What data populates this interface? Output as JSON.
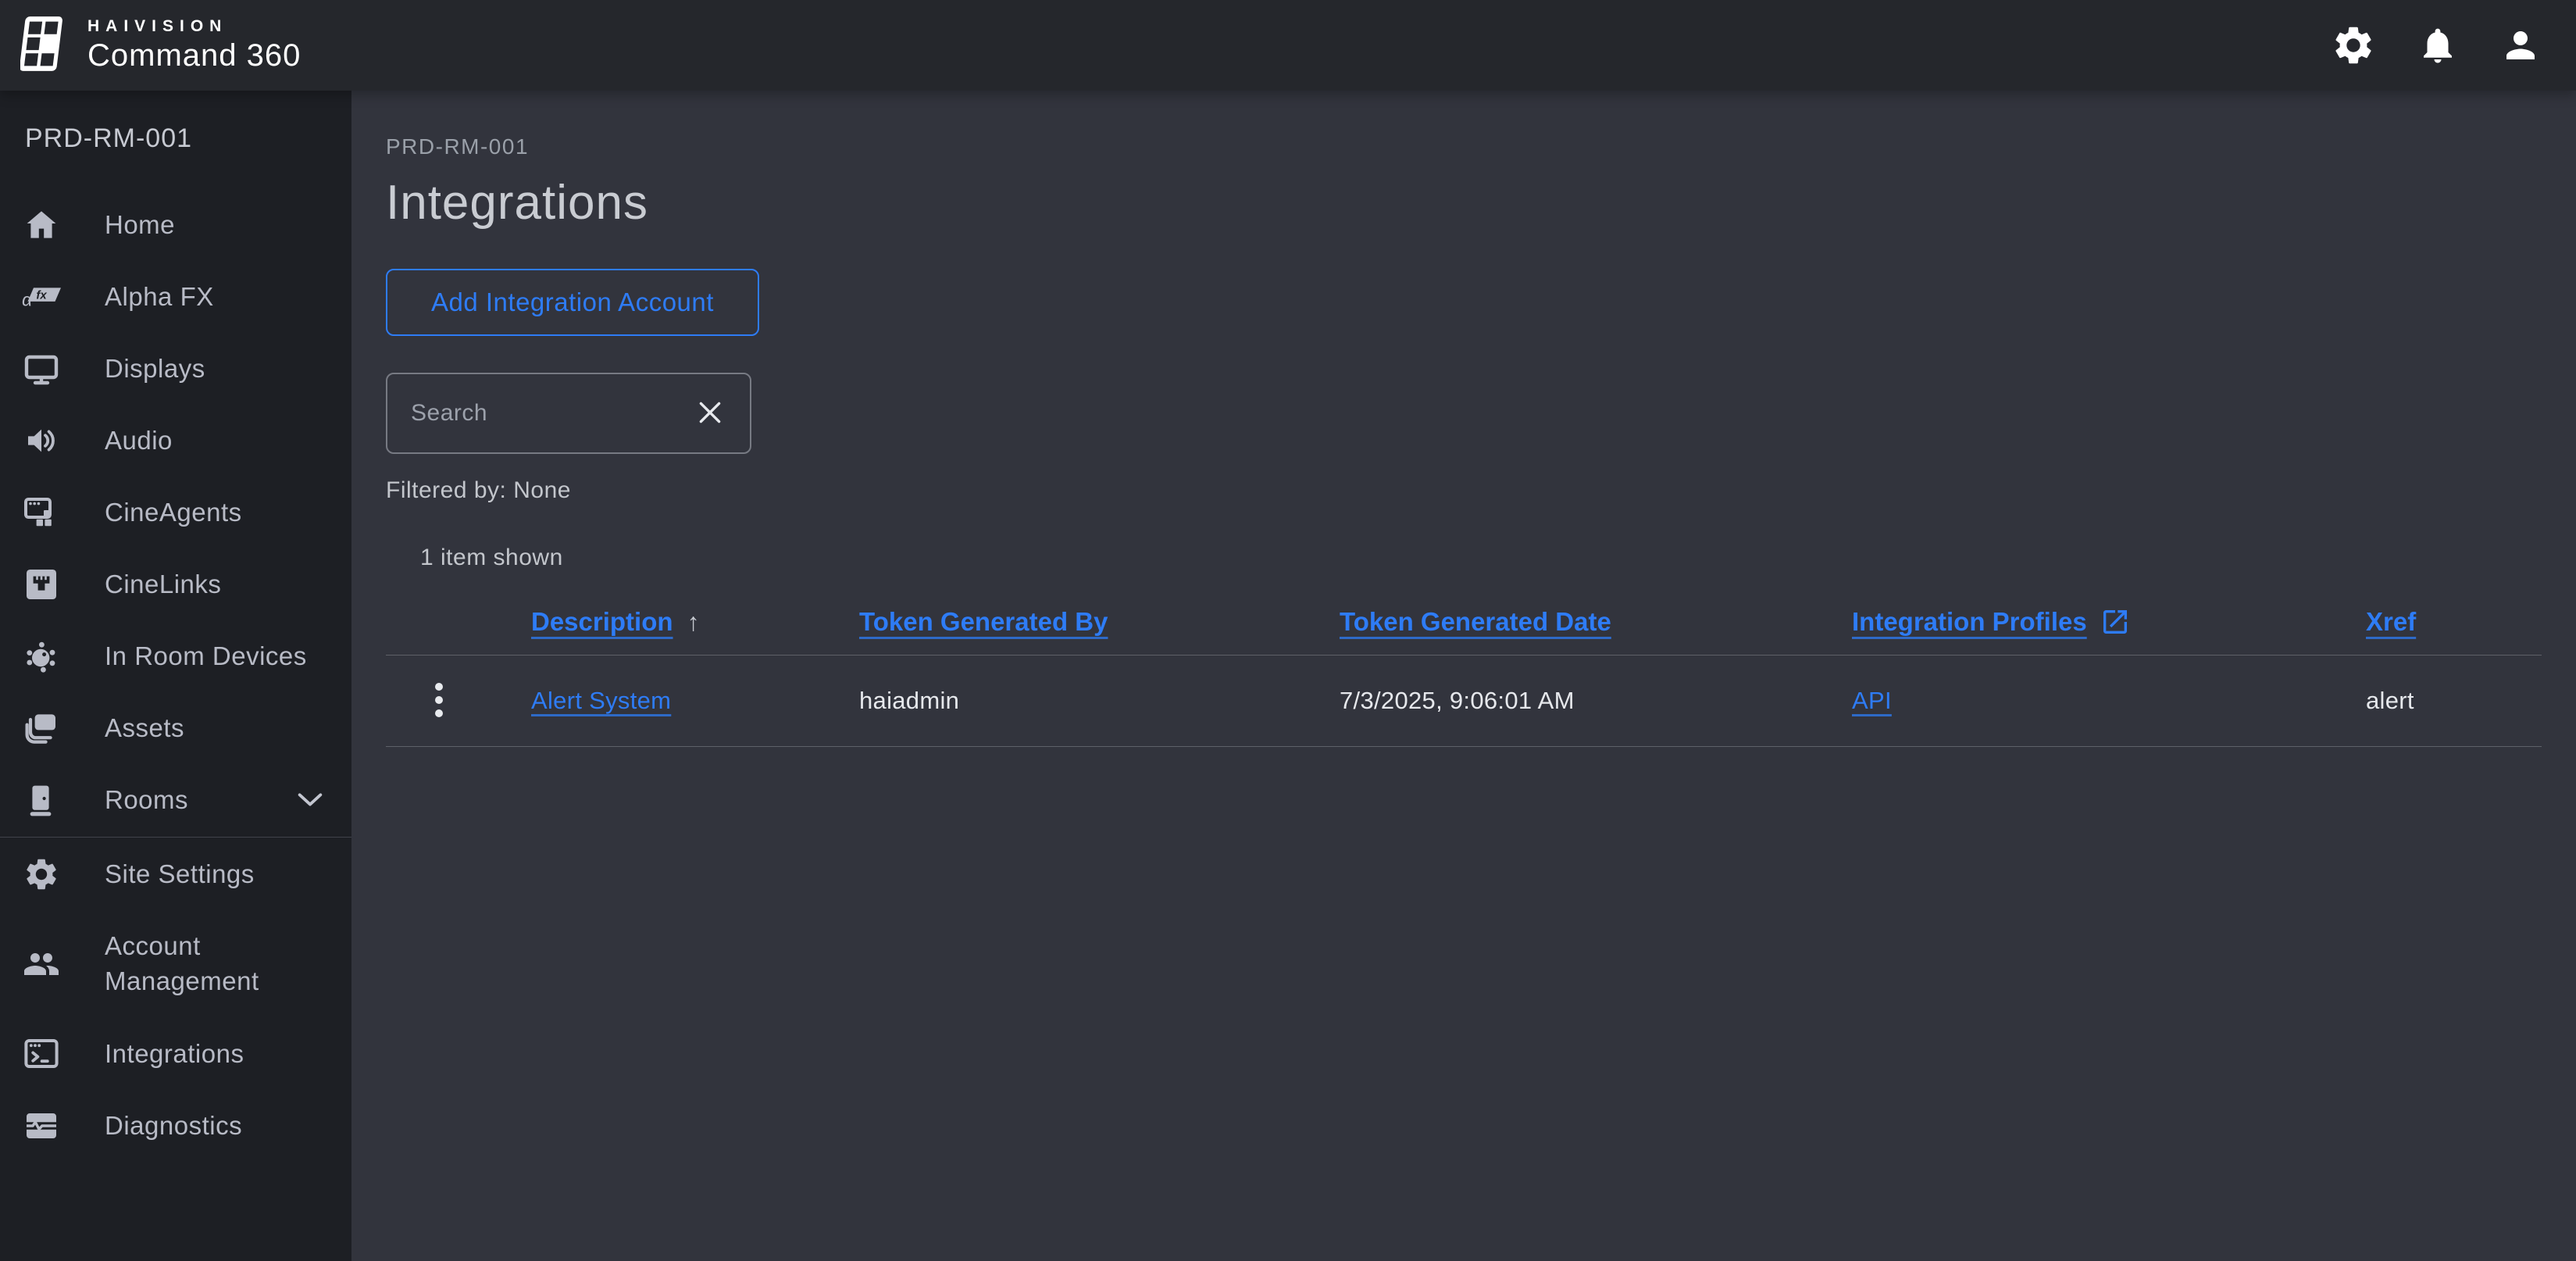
{
  "topbar": {
    "brand_small": "HAIVISION",
    "brand_large": "Command 360",
    "icons": [
      "settings-icon",
      "notifications-icon",
      "account-icon"
    ]
  },
  "sidebar": {
    "room_label": "PRD-RM-001",
    "items": [
      {
        "label": "Home",
        "icon": "home-icon"
      },
      {
        "label": "Alpha FX",
        "icon": "alpha-fx-icon"
      },
      {
        "label": "Displays",
        "icon": "display-icon"
      },
      {
        "label": "Audio",
        "icon": "audio-icon"
      },
      {
        "label": "CineAgents",
        "icon": "cineagents-icon"
      },
      {
        "label": "CineLinks",
        "icon": "cinelinks-icon"
      },
      {
        "label": "In Room Devices",
        "icon": "in-room-devices-icon"
      },
      {
        "label": "Assets",
        "icon": "assets-icon"
      },
      {
        "label": "Rooms",
        "icon": "rooms-icon",
        "expandable": true
      },
      {
        "label": "Site Settings",
        "icon": "site-settings-icon"
      },
      {
        "label": "Account Management",
        "icon": "account-management-icon"
      },
      {
        "label": "Integrations",
        "icon": "integrations-icon"
      },
      {
        "label": "Diagnostics",
        "icon": "diagnostics-icon"
      }
    ]
  },
  "main": {
    "breadcrumb": "PRD-RM-001",
    "title": "Integrations",
    "add_button_label": "Add Integration Account",
    "search": {
      "placeholder": "Search",
      "value": ""
    },
    "filtered_by": "Filtered by: None",
    "items_shown": "1 item shown",
    "table": {
      "sort_indicator": "↑",
      "sorted_column": "Description",
      "sort_direction": "ascending",
      "columns": [
        {
          "label": "Description"
        },
        {
          "label": "Token Generated By"
        },
        {
          "label": "Token Generated Date"
        },
        {
          "label": "Integration Profiles",
          "external_icon": true
        },
        {
          "label": "Xref"
        }
      ],
      "rows": [
        {
          "description": "Alert System",
          "token_generated_by": "haiadmin",
          "token_generated_date": "7/3/2025, 9:06:01 AM",
          "integration_profiles": "API",
          "xref": "alert"
        }
      ]
    }
  },
  "colors": {
    "accent_blue": "#2e7cf6",
    "header_bg": "#25272c",
    "sidebar_bg": "#1d1f24",
    "main_bg": "#32343d"
  }
}
